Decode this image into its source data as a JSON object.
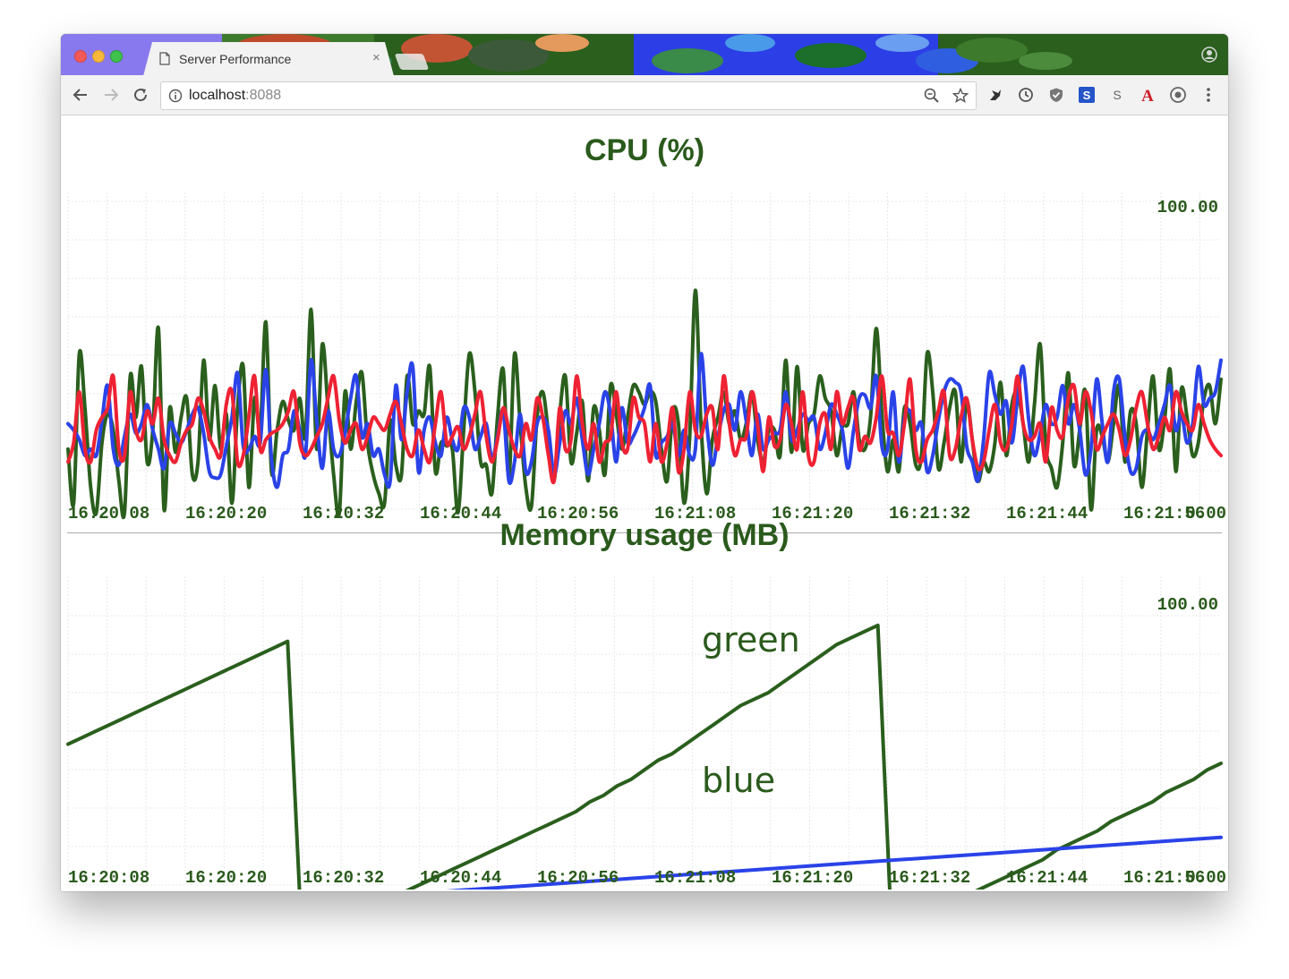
{
  "browser": {
    "tab_title": "Server Performance",
    "tab_close": "×",
    "url_host": "localhost",
    "url_port": ":8088"
  },
  "charts": {
    "cpu": {
      "title": "CPU (%)",
      "max_label": "100.00",
      "min_label": "0.00",
      "time_labels": [
        "16:20:08",
        "16:20:20",
        "16:20:32",
        "16:20:44",
        "16:20:56",
        "16:21:08",
        "16:21:20",
        "16:21:32",
        "16:21:44",
        "16:21:56"
      ]
    },
    "memory": {
      "title": "Memory usage (MB)",
      "max_label": "100.00",
      "min_label": "0.00",
      "time_labels": [
        "16:20:08",
        "16:20:20",
        "16:20:32",
        "16:20:44",
        "16:20:56",
        "16:21:08",
        "16:21:20",
        "16:21:32",
        "16:21:44",
        "16:21:56"
      ],
      "series_labels": [
        "green",
        "blue"
      ]
    }
  },
  "colors": {
    "title": "#2a5a1c",
    "green": "#2a5f1d",
    "blue": "#2a43e8",
    "red": "#ee2233",
    "grid": "#e8e8e8"
  },
  "chart_data": [
    {
      "type": "line",
      "title": "CPU (%)",
      "x_tick_labels": [
        "16:20:08",
        "16:20:20",
        "16:20:32",
        "16:20:44",
        "16:20:56",
        "16:21:08",
        "16:21:20",
        "16:21:32",
        "16:21:44",
        "16:21:56"
      ],
      "ylim": [
        0,
        100
      ],
      "grid": true,
      "series": [
        {
          "color": "#2a5f1d",
          "values": [
            22,
            5,
            52,
            35,
            10,
            2,
            24,
            33,
            28,
            12,
            2,
            45,
            32,
            48,
            18,
            28,
            60,
            3,
            35,
            21,
            32,
            38,
            14,
            18,
            50,
            25,
            42,
            22,
            33,
            5,
            35,
            48,
            10,
            38,
            28,
            62,
            15,
            28,
            37,
            31,
            28,
            38,
            26,
            66,
            22,
            55,
            35,
            14,
            2,
            40,
            22,
            37,
            46,
            24,
            14,
            8,
            5,
            31,
            17,
            14,
            45,
            30,
            34,
            33,
            48,
            15,
            24,
            23,
            22,
            2,
            28,
            52,
            40,
            18,
            17,
            8,
            32,
            47,
            13,
            52,
            30,
            10,
            4,
            32,
            40,
            27,
            12,
            33,
            45,
            18,
            27,
            37,
            12,
            35,
            28,
            14,
            42,
            33,
            22,
            32,
            42,
            40,
            36,
            40,
            37,
            22,
            12,
            34,
            30,
            5,
            26,
            72,
            30,
            8,
            25,
            32,
            40,
            30,
            34,
            25,
            30,
            40,
            25,
            18,
            28,
            28,
            20,
            50,
            21,
            48,
            22,
            30,
            33,
            45,
            38,
            34,
            20,
            29,
            30,
            40,
            25,
            22,
            32,
            60,
            33,
            15,
            25,
            15,
            35,
            30,
            17,
            20,
            52,
            40,
            16,
            24,
            35,
            40,
            18,
            37,
            25,
            12,
            18,
            15,
            24,
            43,
            20,
            36,
            40,
            30,
            18,
            36,
            55,
            23,
            16,
            10,
            24,
            46,
            17,
            28,
            40,
            3,
            28,
            26,
            18,
            30,
            42,
            18,
            34,
            30,
            10,
            28,
            45,
            22,
            31,
            47,
            15,
            41,
            32,
            20,
            24,
            38,
            42,
            30,
            44
          ]
        },
        {
          "color": "#2a43e8",
          "values": [
            30,
            28,
            25,
            20,
            22,
            20,
            31,
            42,
            22,
            17,
            26,
            33,
            27,
            30,
            36,
            28,
            22,
            16,
            30,
            27,
            24,
            28,
            33,
            35,
            27,
            15,
            13,
            14,
            23,
            32,
            46,
            23,
            22,
            26,
            24,
            47,
            19,
            10,
            20,
            22,
            34,
            28,
            20,
            50,
            31,
            16,
            34,
            22,
            20,
            27,
            38,
            45,
            26,
            30,
            20,
            22,
            14,
            12,
            42,
            25,
            40,
            48,
            15,
            28,
            32,
            24,
            20,
            32,
            25,
            22,
            35,
            32,
            22,
            26,
            30,
            19,
            26,
            34,
            12,
            18,
            33,
            15,
            18,
            30,
            32,
            28,
            14,
            24,
            34,
            30,
            38,
            25,
            14,
            22,
            30,
            40,
            33,
            18,
            35,
            24,
            26,
            30,
            35,
            42,
            20,
            24,
            26,
            30,
            20,
            28,
            20,
            22,
            52,
            30,
            17,
            26,
            34,
            36,
            28,
            40,
            31,
            20,
            33,
            22,
            25,
            27,
            28,
            40,
            25,
            28,
            33,
            31,
            32,
            22,
            27,
            36,
            33,
            28,
            16,
            28,
            38,
            39,
            35,
            45,
            23,
            22,
            40,
            18,
            32,
            34,
            28,
            30,
            15,
            20,
            31,
            40,
            44,
            43,
            40,
            23,
            18,
            12,
            25,
            46,
            39,
            33,
            37,
            24,
            38,
            48,
            31,
            20,
            27,
            36,
            30,
            32,
            42,
            30,
            36,
            28,
            14,
            22,
            44,
            30,
            18,
            40,
            44,
            26,
            15,
            16,
            26,
            28,
            25,
            30,
            36,
            42,
            28,
            33,
            24,
            30,
            48,
            36,
            38,
            40,
            50
          ]
        },
        {
          "color": "#ee2233",
          "values": [
            18,
            24,
            40,
            22,
            18,
            28,
            32,
            35,
            45,
            22,
            20,
            40,
            28,
            25,
            34,
            30,
            38,
            25,
            20,
            18,
            24,
            28,
            30,
            38,
            34,
            26,
            22,
            20,
            36,
            40,
            18,
            20,
            32,
            45,
            22,
            25,
            27,
            28,
            30,
            34,
            40,
            24,
            20,
            22,
            26,
            30,
            38,
            45,
            31,
            24,
            28,
            30,
            22,
            26,
            32,
            30,
            28,
            33,
            37,
            30,
            22,
            20,
            28,
            22,
            18,
            30,
            40,
            24,
            26,
            29,
            22,
            26,
            33,
            40,
            26,
            18,
            25,
            35,
            28,
            22,
            20,
            30,
            25,
            38,
            32,
            20,
            12,
            35,
            22,
            25,
            45,
            30,
            22,
            30,
            18,
            24,
            26,
            40,
            24,
            22,
            38,
            32,
            30,
            18,
            30,
            18,
            24,
            35,
            15,
            22,
            40,
            28,
            26,
            33,
            35,
            22,
            45,
            30,
            20,
            25,
            26,
            40,
            30,
            15,
            32,
            23,
            25,
            36,
            30,
            22,
            40,
            20,
            18,
            30,
            33,
            22,
            40,
            30,
            35,
            38,
            22,
            26,
            24,
            32,
            45,
            28,
            27,
            20,
            30,
            44,
            22,
            18,
            25,
            28,
            34,
            40,
            20,
            22,
            32,
            38,
            25,
            16,
            18,
            28,
            36,
            24,
            22,
            30,
            45,
            30,
            25,
            26,
            30,
            18,
            35,
            28,
            26,
            38,
            42,
            30,
            40,
            34,
            22,
            26,
            30,
            33,
            28,
            20,
            25,
            35,
            40,
            30,
            22,
            26,
            32,
            28,
            40,
            34,
            30,
            28,
            36,
            30,
            25,
            22,
            20
          ]
        }
      ]
    },
    {
      "type": "line",
      "title": "Memory usage (MB)",
      "x_tick_labels": [
        "16:20:08",
        "16:20:20",
        "16:20:32",
        "16:20:44",
        "16:20:56",
        "16:21:08",
        "16:21:20",
        "16:21:32",
        "16:21:44",
        "16:21:56"
      ],
      "ylim": [
        0,
        100
      ],
      "grid": true,
      "series": [
        {
          "name": "green",
          "color": "#2a5f1d",
          "values": [
            60,
            62,
            64,
            66,
            68,
            70,
            72,
            74,
            76,
            78,
            80,
            82,
            84,
            86,
            88,
            90,
            92,
            2,
            4,
            6,
            7,
            9,
            10,
            12,
            13,
            15,
            17,
            19,
            21,
            23,
            25,
            27,
            29,
            31,
            33,
            35,
            37,
            39,
            42,
            44,
            47,
            49,
            52,
            55,
            57,
            60,
            63,
            66,
            69,
            72,
            74,
            76,
            79,
            82,
            85,
            88,
            91,
            93,
            95,
            97,
            2,
            4,
            6,
            8,
            10,
            12,
            14,
            16,
            18,
            20,
            22,
            24,
            27,
            29,
            31,
            33,
            36,
            38,
            40,
            42,
            45,
            47,
            49,
            52,
            54
          ]
        },
        {
          "name": "blue",
          "color": "#2a43e8",
          "values": [
            6,
            7,
            8,
            9,
            10,
            11,
            12,
            13,
            14,
            15,
            16,
            17,
            18,
            19,
            20,
            21,
            22,
            23,
            24,
            25,
            26,
            27,
            28,
            29,
            30,
            31
          ]
        },
        {
          "color": "#ee2233",
          "values": [
            1,
            1
          ]
        }
      ]
    }
  ]
}
